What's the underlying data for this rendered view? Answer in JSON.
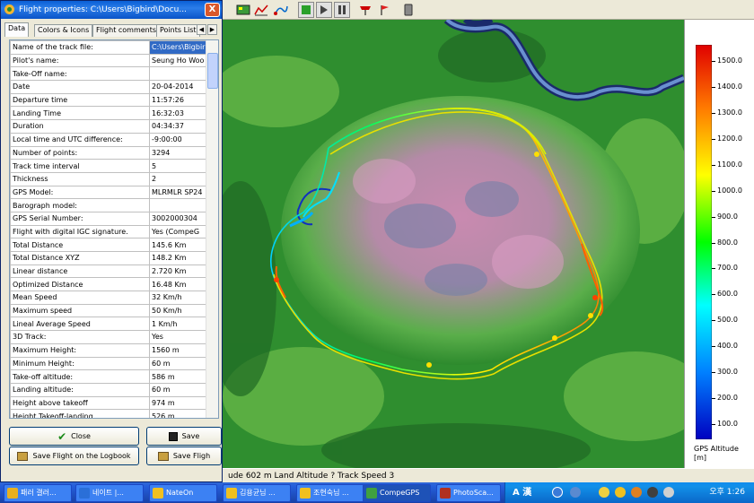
{
  "dialog": {
    "title": "Flight properties: C:\\Users\\Bigbird\\Docu...",
    "close_glyph": "X",
    "tabs": [
      "Data",
      "Colors & Icons",
      "Flight comments:",
      "Points List"
    ],
    "rows": [
      {
        "label": "Name of the track file:",
        "value": "C:\\Users\\Bigbir"
      },
      {
        "label": "Pilot's name:",
        "value": "Seung Ho Woo"
      },
      {
        "label": "Take-Off name:",
        "value": ""
      },
      {
        "label": "Date",
        "value": "20-04-2014"
      },
      {
        "label": "Departure time",
        "value": "11:57:26"
      },
      {
        "label": "Landing Time",
        "value": "16:32:03"
      },
      {
        "label": "Duration",
        "value": "04:34:37"
      },
      {
        "label": "Local time and UTC difference:",
        "value": "-9:00:00"
      },
      {
        "label": "Number of points:",
        "value": "3294"
      },
      {
        "label": "Track time interval",
        "value": "5"
      },
      {
        "label": "Thickness",
        "value": "2"
      },
      {
        "label": "GPS Model:",
        "value": "MLRMLR  SP24"
      },
      {
        "label": "Barograph model:",
        "value": ""
      },
      {
        "label": "GPS Serial Number:",
        "value": "3002000304"
      },
      {
        "label": "Flight with digital IGC signature.",
        "value": "Yes   (CompeG"
      },
      {
        "label": "Total Distance",
        "value": "145.6 Km"
      },
      {
        "label": "Total Distance XYZ",
        "value": "148.2 Km"
      },
      {
        "label": "Linear distance",
        "value": "2.720 Km"
      },
      {
        "label": "Optimized Distance",
        "value": "16.48 Km"
      },
      {
        "label": "Mean Speed",
        "value": "32 Km/h"
      },
      {
        "label": "Maximum speed",
        "value": "50 Km/h"
      },
      {
        "label": "Lineal Average Speed",
        "value": "1 Km/h"
      },
      {
        "label": "3D Track:",
        "value": "Yes"
      },
      {
        "label": "Maximum Height:",
        "value": "1560 m"
      },
      {
        "label": "Minimum Height:",
        "value": "60 m"
      },
      {
        "label": "Take-off altitude:",
        "value": "586 m"
      },
      {
        "label": "Landing altitude:",
        "value": "60 m"
      },
      {
        "label": "Height above takeoff",
        "value": "974 m"
      },
      {
        "label": "Height Takeoff-landing",
        "value": "526 m"
      }
    ],
    "buttons": {
      "close": "Close",
      "save": "Save",
      "save_logbook": "Save Flight on the Logbook",
      "save_flight": "Save Fligh"
    }
  },
  "legend": {
    "ticks": [
      "1500.0",
      "1400.0",
      "1300.0",
      "1200.0",
      "1100.0",
      "1000.0",
      "900.0",
      "800.0",
      "700.0",
      "600.0",
      "500.0",
      "400.0",
      "300.0",
      "200.0",
      "100.0"
    ],
    "title": "GPS Altitude [m]",
    "gradient_colors": [
      "#e00000",
      "#ff7a00",
      "#ffff00",
      "#00ff00",
      "#00ffff",
      "#0080ff",
      "#0000c0"
    ]
  },
  "statusbar": {
    "text": "ude 602 m Land Altitude ? Track Speed 3"
  },
  "taskbar": {
    "items": [
      {
        "label": "패러 갤러...",
        "icon_color": "#e8b020"
      },
      {
        "label": "네이트 |...",
        "icon_color": "#2a6fd8"
      },
      {
        "label": "NateOn",
        "icon_color": "#f0c020"
      },
      {
        "label": "김용균님 ...",
        "icon_color": "#f0c020"
      },
      {
        "label": "조현숙님 ...",
        "icon_color": "#f0c020"
      },
      {
        "label": "CompeGPS",
        "icon_color": "#40a040"
      },
      {
        "label": "PhotoSca...",
        "icon_color": "#b03020"
      }
    ],
    "tray_text": "A 漢",
    "clock": "오후 1:26"
  },
  "toolbar": {
    "icons": [
      "map-tool-icon",
      "chart-icon",
      "route-icon",
      "play-icon",
      "step-icon",
      "pause-icon",
      "flight-icon",
      "pin-icon",
      "phone-icon"
    ]
  }
}
